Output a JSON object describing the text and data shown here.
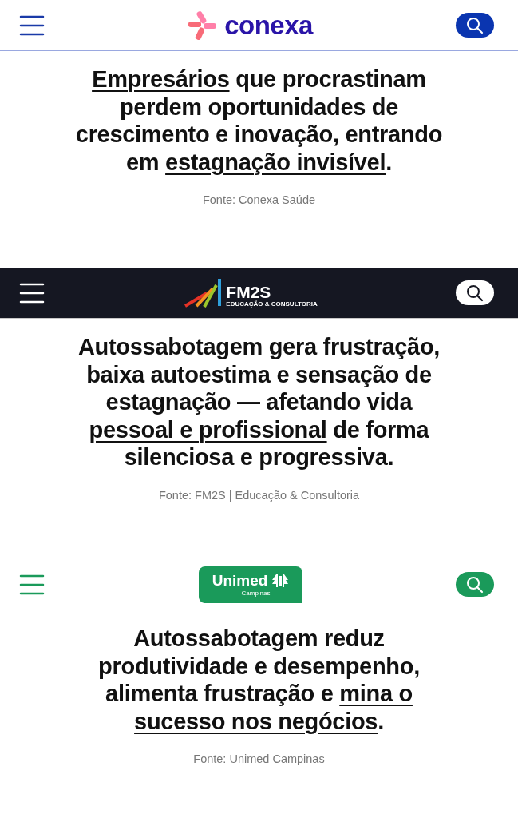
{
  "sections": [
    {
      "header": {
        "kind": "conexa",
        "logo_text": "conexa"
      },
      "quote": [
        [
          {
            "text": "Empresários",
            "underlined": true
          },
          {
            "text": " que procrastinam",
            "underlined": false
          }
        ],
        [
          {
            "text": "perdem oportunidades de",
            "underlined": false
          }
        ],
        [
          {
            "text": "crescimento e inovação, entrando",
            "underlined": false
          }
        ],
        [
          {
            "text": "em ",
            "underlined": false
          },
          {
            "text": "estagnação invisível",
            "underlined": true
          },
          {
            "text": ".",
            "underlined": false
          }
        ]
      ],
      "source": "Fonte: Conexa Saúde"
    },
    {
      "header": {
        "kind": "fm2s",
        "logo_text": "FM2S",
        "logo_subtext": "EDUCAÇÃO & CONSULTORIA"
      },
      "quote": [
        [
          {
            "text": "Autossabotagem gera frustração,",
            "underlined": false
          }
        ],
        [
          {
            "text": "baixa autoestima e sensação de",
            "underlined": false
          }
        ],
        [
          {
            "text": "estagnação — afetando vida",
            "underlined": false
          }
        ],
        [
          {
            "text": "pessoal e profissional",
            "underlined": true
          },
          {
            "text": " de forma",
            "underlined": false
          }
        ],
        [
          {
            "text": "silenciosa e progressiva.",
            "underlined": false
          }
        ]
      ],
      "source": "Fonte: FM2S | Educação & Consultoria"
    },
    {
      "header": {
        "kind": "unimed",
        "logo_text": "Unimed",
        "logo_subtext": "Campinas"
      },
      "quote": [
        [
          {
            "text": "Autossabotagem reduz",
            "underlined": false
          }
        ],
        [
          {
            "text": "produtividade e desempenho,",
            "underlined": false
          }
        ],
        [
          {
            "text": "alimenta frustração e ",
            "underlined": false
          },
          {
            "text": "mina o",
            "underlined": true
          }
        ],
        [
          {
            "text": "sucesso nos negócios",
            "underlined": true
          },
          {
            "text": ".",
            "underlined": false
          }
        ]
      ],
      "source": "Fonte: Unimed Campinas"
    }
  ]
}
